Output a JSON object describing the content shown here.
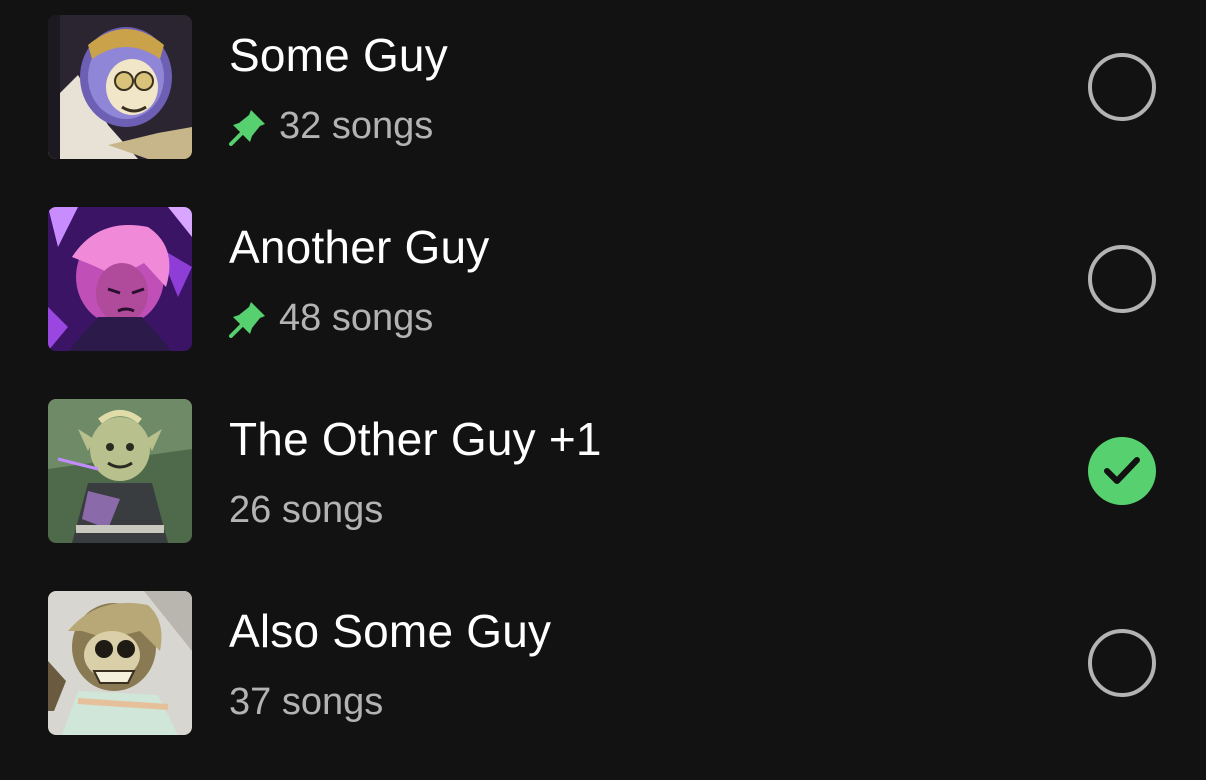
{
  "playlists": [
    {
      "name": "Some Guy",
      "count": "32 songs",
      "pinned": true,
      "selected": false,
      "cover_icon": "armored-character-art"
    },
    {
      "name": "Another Guy",
      "count": "48 songs",
      "pinned": true,
      "selected": false,
      "cover_icon": "pink-haired-character-art"
    },
    {
      "name": "The Other Guy +1",
      "count": "26 songs",
      "pinned": false,
      "selected": true,
      "cover_icon": "goblin-character-art"
    },
    {
      "name": "Also Some Guy",
      "count": "37 songs",
      "pinned": false,
      "selected": false,
      "cover_icon": "masked-character-art"
    }
  ],
  "colors": {
    "background": "#121212",
    "accent": "#57d16f",
    "title": "#ffffff",
    "subtitle": "#b3b3b3",
    "radio_border": "#b3b3b3"
  },
  "icons": {
    "pin": "pin-icon",
    "radio_unchecked": "radio-unchecked-icon",
    "radio_checked": "check-circle-icon"
  }
}
